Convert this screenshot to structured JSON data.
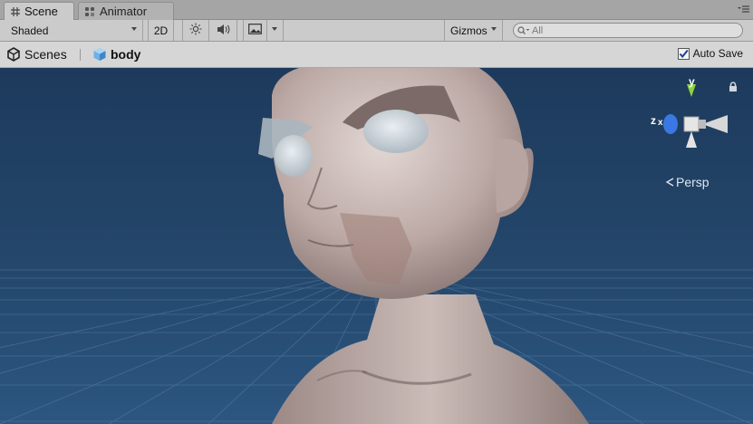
{
  "tabs": [
    {
      "label": "Scene",
      "icon": "grid-icon",
      "active": true
    },
    {
      "label": "Animator",
      "icon": "animator-icon",
      "active": false
    }
  ],
  "toolbar": {
    "shading_mode": "Shaded",
    "mode_2d": "2D",
    "gizmos_label": "Gizmos",
    "search_placeholder": "All"
  },
  "breadcrumb": {
    "root_label": "Scenes",
    "object_label": "body"
  },
  "autosave": {
    "label": "Auto Save",
    "checked": true
  },
  "viewport": {
    "projection_label": "Persp",
    "gizmo_y_label": "y",
    "gizmo_z_label": "z",
    "gizmo_x_label": "x",
    "colors": {
      "sky": "#1d3a5c",
      "grid": "#5c82ad",
      "skin": "#bda9a5"
    }
  }
}
